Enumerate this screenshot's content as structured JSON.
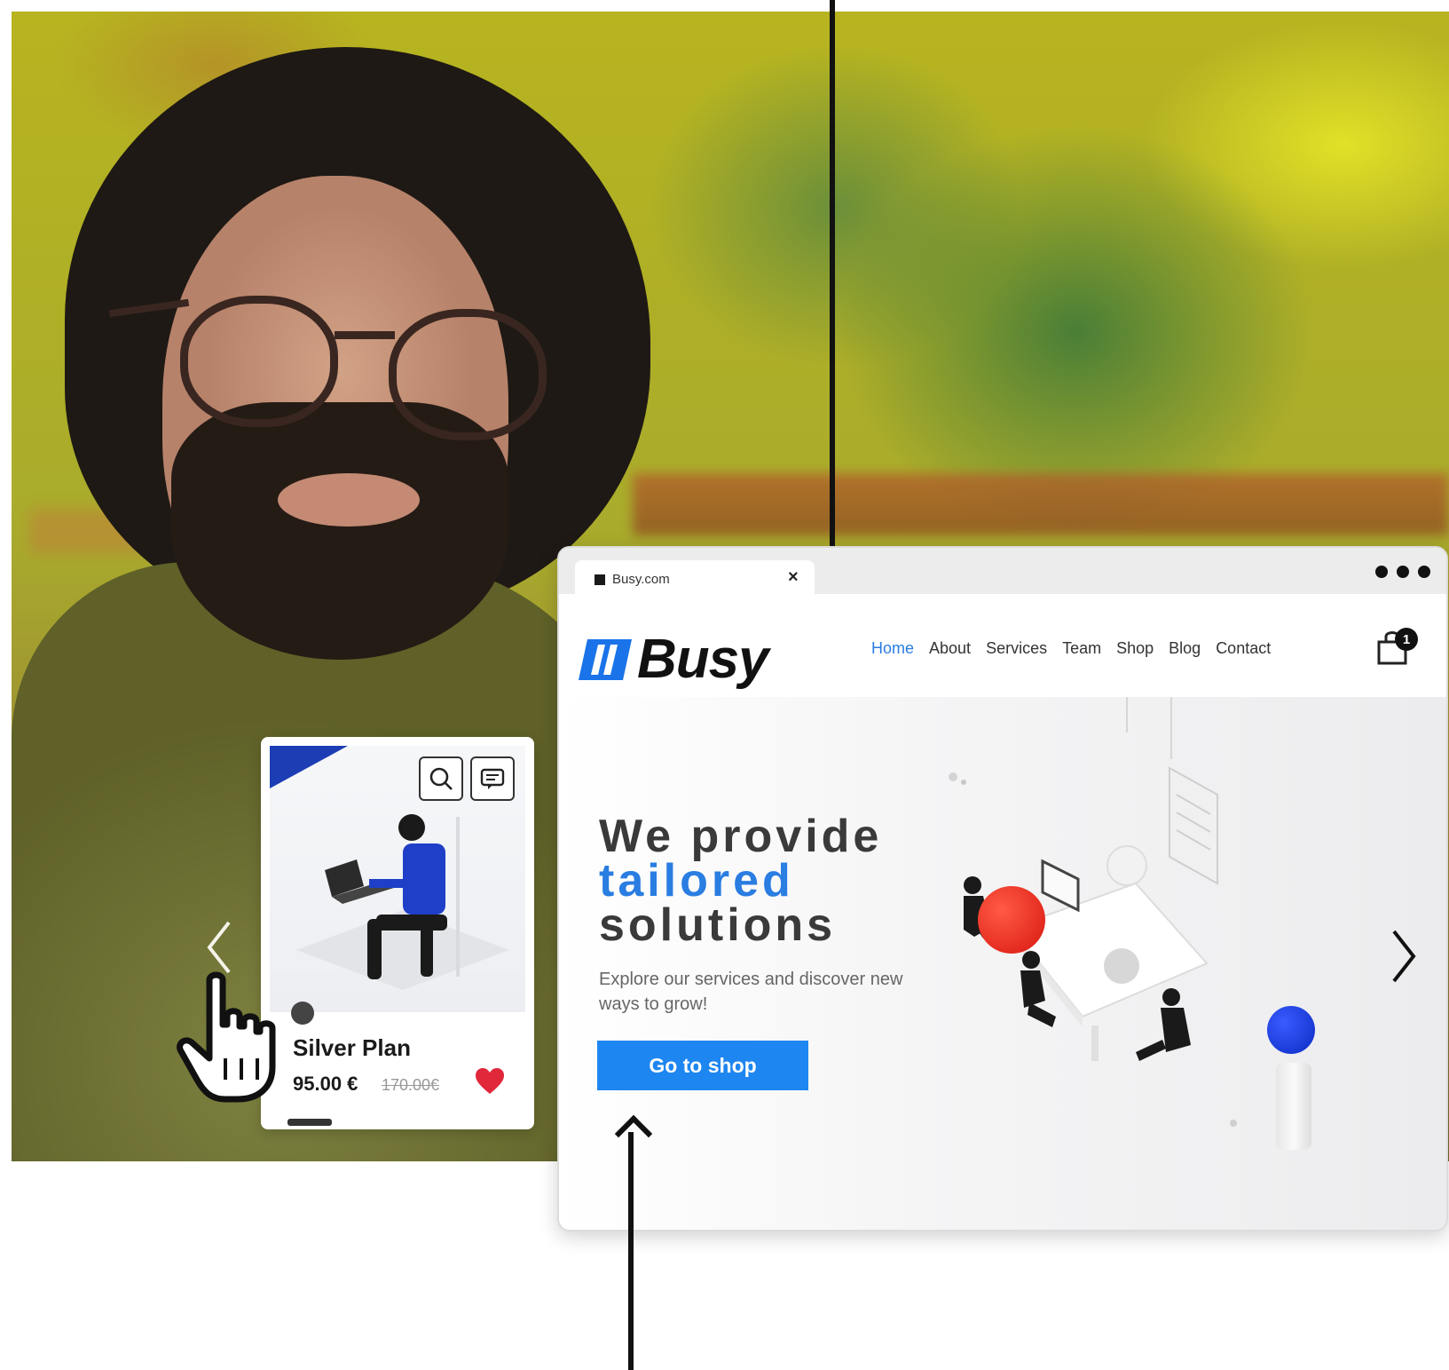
{
  "browser": {
    "tab_title": "Busy.com",
    "tab_close": "×"
  },
  "site": {
    "logo_text": "Busy",
    "nav": [
      "Home",
      "About",
      "Services",
      "Team",
      "Shop",
      "Blog",
      "Contact"
    ],
    "active_nav": "Home",
    "cart_count": "1"
  },
  "hero": {
    "line1": "We provide",
    "line2": "tailored",
    "line3": "solutions",
    "subtitle": "Explore our services and discover new ways to grow!",
    "cta": "Go to shop"
  },
  "product_card": {
    "name": "Silver Plan",
    "price": "95.00 €",
    "old_price": "170.00€"
  },
  "colors": {
    "accent_blue": "#1e86f0",
    "nav_active": "#2a7de1",
    "dark_blue": "#1d3db4",
    "heart_red": "#e0283a",
    "ball_red": "#d8170f"
  },
  "icons": [
    "search-icon",
    "chat-icon",
    "heart-icon",
    "cart-icon",
    "chevron-left-icon",
    "chevron-right-icon",
    "hand-pointer-icon",
    "favicon-icon"
  ]
}
